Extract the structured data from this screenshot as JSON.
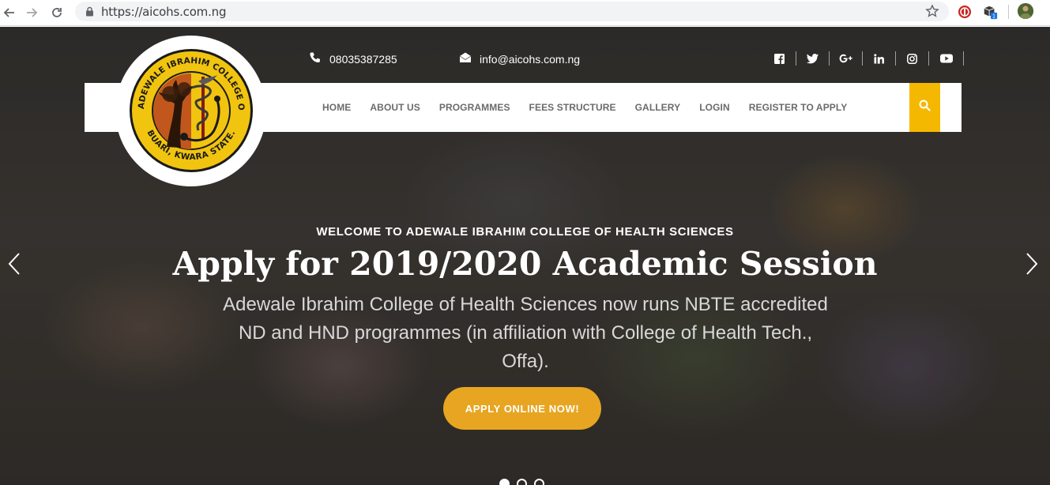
{
  "browser": {
    "url": "https://aicohs.com.ng",
    "extension_badge": "1"
  },
  "topbar": {
    "phone": "08035387285",
    "email": "info@aicohs.com.ng",
    "socials": [
      "facebook-icon",
      "twitter-icon",
      "google-plus-icon",
      "linkedin-icon",
      "instagram-icon",
      "youtube-icon"
    ]
  },
  "logo": {
    "text_top": "ADEWALE IBRAHIM COLLEGE OF HEALTH SCIENCES",
    "text_bottom": "BUARI, KWARA STATE."
  },
  "nav": {
    "items": [
      "HOME",
      "ABOUT US",
      "PROGRAMMES",
      "FEES STRUCTURE",
      "GALLERY",
      "LOGIN",
      "REGISTER TO APPLY"
    ],
    "search_color": "#f5b800"
  },
  "hero": {
    "welcome": "WELCOME TO ADEWALE IBRAHIM COLLEGE OF HEALTH SCIENCES",
    "headline": "Apply for 2019/2020 Academic Session",
    "subtext": "Adewale Ibrahim College of Health Sciences now runs NBTE accredited ND and HND programmes (in affiliation with College of Health Tech., Offa).",
    "cta": "APPLY ONLINE NOW!",
    "cta_color": "#e8a521",
    "slides_count": 3,
    "active_slide": 1
  }
}
